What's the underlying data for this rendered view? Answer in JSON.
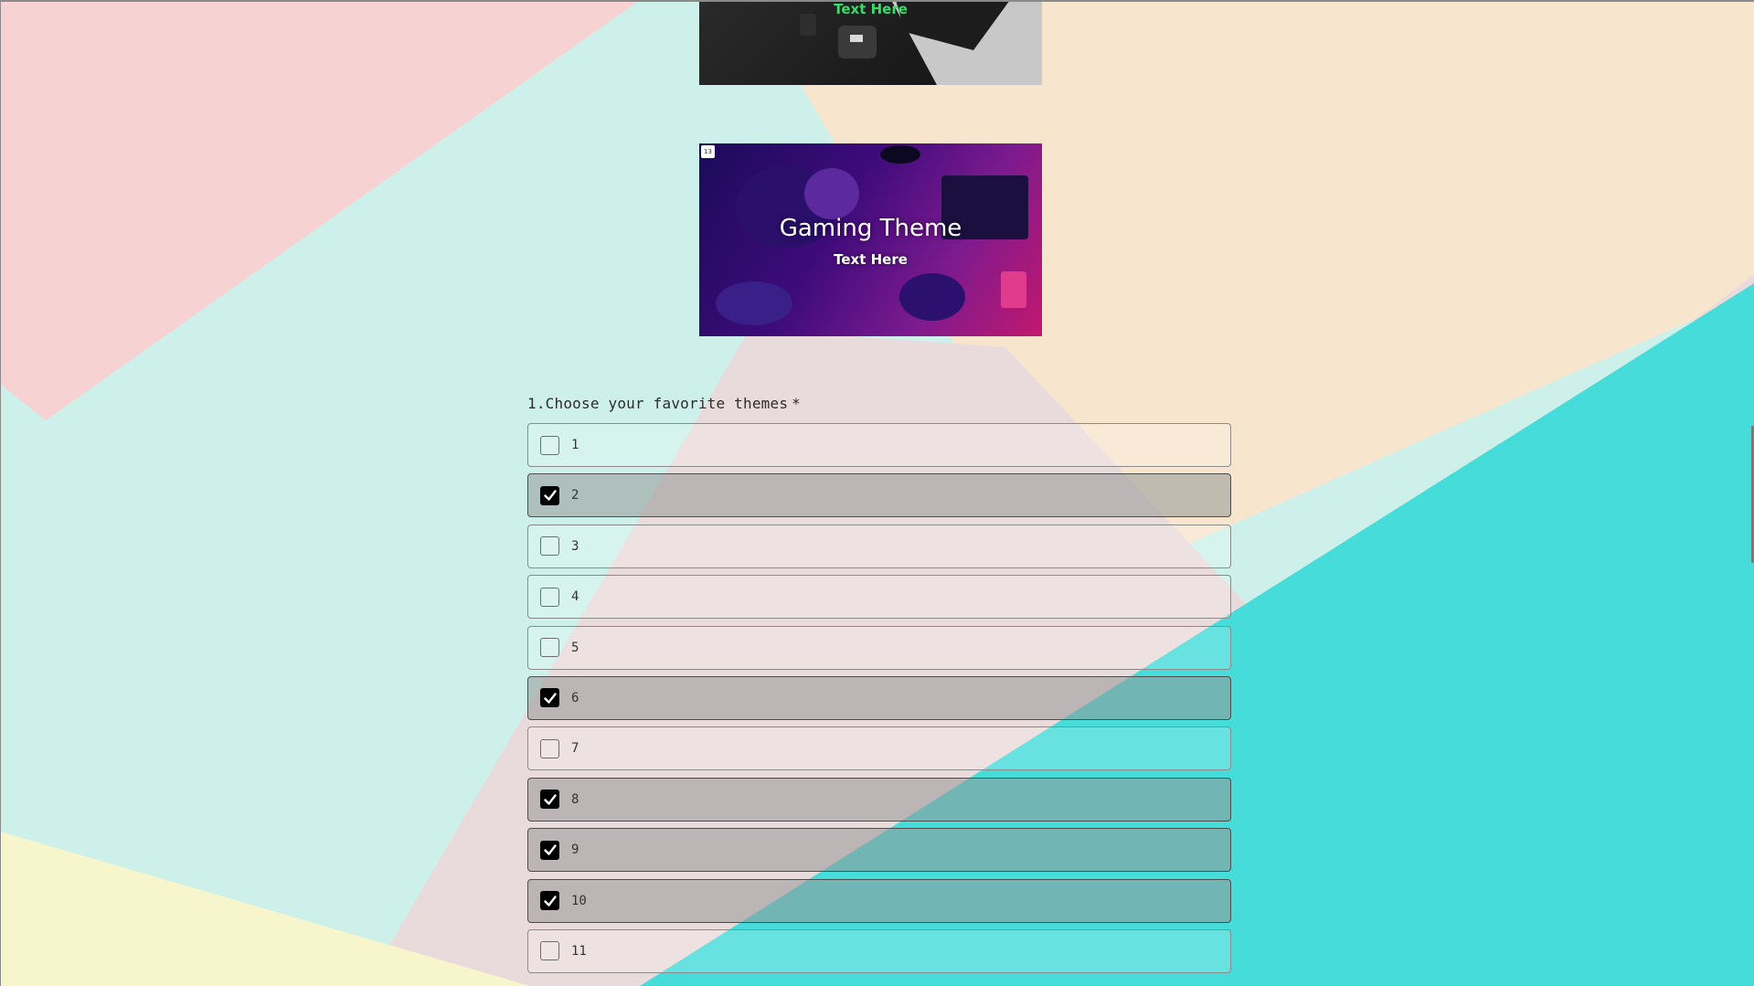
{
  "background_colors": {
    "pink": "#f6d2d3",
    "mint": "#cdf1ea",
    "peach": "#f7e6cd",
    "cyan": "#46dcd9",
    "yellow": "#f7f5cc",
    "lavender": "#e9dbdc"
  },
  "cards": {
    "laptop": {
      "subtitle": "Text Here",
      "subtitle_color": "#3cd96b"
    },
    "gaming": {
      "badge": "13",
      "title": "Gaming Theme",
      "subtitle": "Text Here"
    }
  },
  "question": {
    "number": "1.",
    "label": "Choose your favorite themes",
    "required_marker": "*"
  },
  "options": [
    {
      "label": "1",
      "checked": false
    },
    {
      "label": "2",
      "checked": true
    },
    {
      "label": "3",
      "checked": false
    },
    {
      "label": "4",
      "checked": false
    },
    {
      "label": "5",
      "checked": false
    },
    {
      "label": "6",
      "checked": true
    },
    {
      "label": "7",
      "checked": false
    },
    {
      "label": "8",
      "checked": true
    },
    {
      "label": "9",
      "checked": true
    },
    {
      "label": "10",
      "checked": true
    },
    {
      "label": "11",
      "checked": false
    }
  ],
  "icons": {
    "checkbox_checked": "checkmark-icon"
  }
}
